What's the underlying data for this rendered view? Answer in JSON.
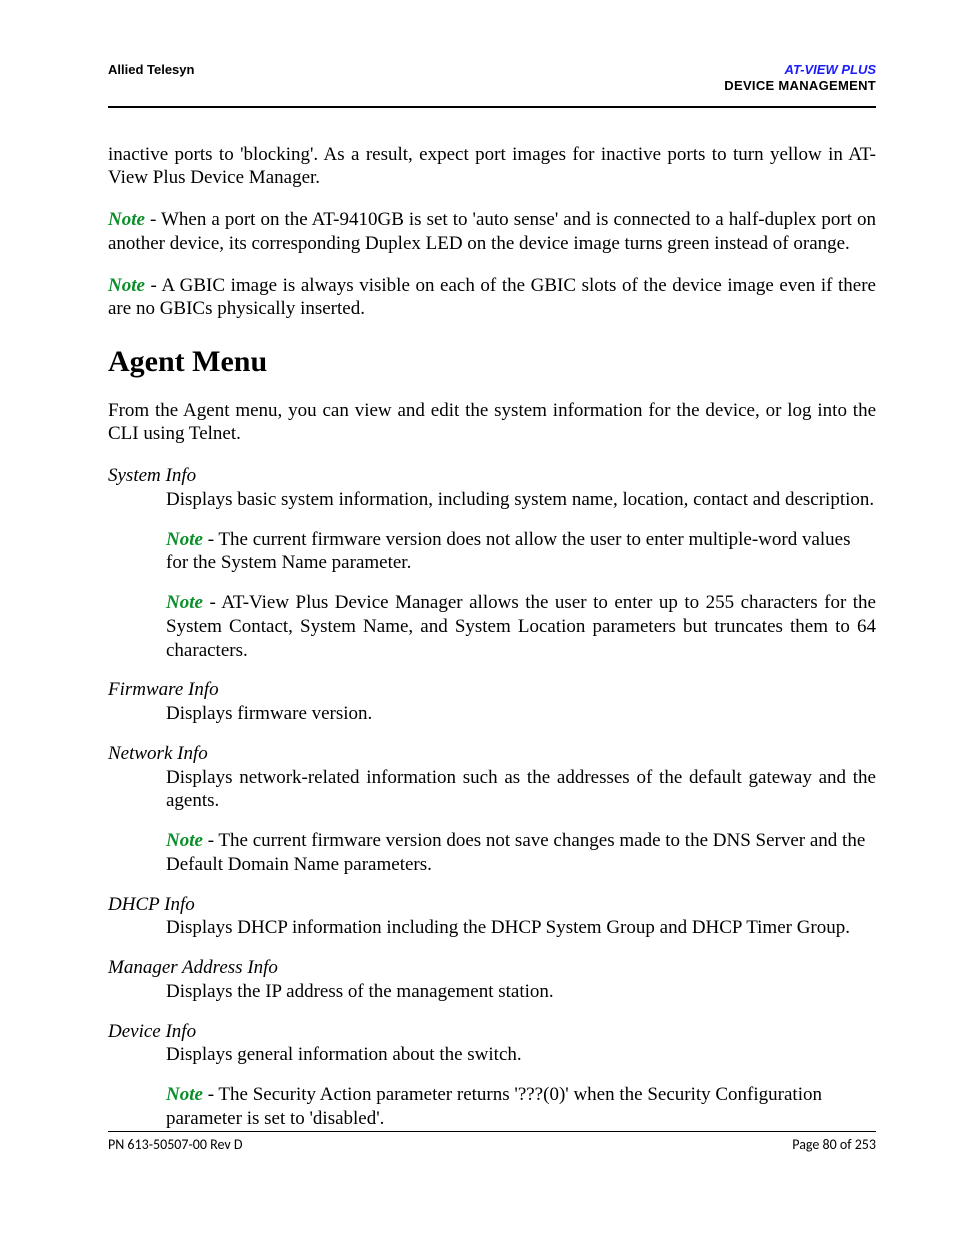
{
  "header": {
    "left": "Allied Telesyn",
    "product": "AT-VIEW PLUS",
    "doc_title": "DEVICE MANAGEMENT"
  },
  "intro_para": "inactive ports to 'blocking'. As a result, expect port images for inactive ports to turn yellow in AT-View Plus Device Manager.",
  "top_notes": [
    {
      "label": "Note",
      "text": " - When a port on the AT-9410GB is set to 'auto sense' and is connected to a half-duplex port on another device, its corresponding Duplex LED on the device image turns green instead of orange."
    },
    {
      "label": "Note",
      "text": " - A GBIC image is always visible on each of the GBIC slots of the device image even if there are no GBICs physically inserted."
    }
  ],
  "section_heading": "Agent Menu",
  "section_intro": "From the Agent menu, you can view and edit the system information for the device, or log into the CLI using Telnet.",
  "items": [
    {
      "term": "System Info",
      "desc": "Displays basic system information, including system name, location, contact and description.",
      "notes": [
        {
          "label": "Note",
          "text": " - The current firmware version does not allow the user to enter multiple-word values for the System Name parameter."
        },
        {
          "label": "Note",
          "text": " - AT-View Plus Device Manager allows the user to enter up to 255 characters for the System Contact, System Name, and System Location parameters but truncates them to 64 characters.",
          "justify": true
        }
      ]
    },
    {
      "term": "Firmware Info",
      "desc": "Displays firmware version.",
      "notes": []
    },
    {
      "term": "Network Info",
      "desc": "Displays network-related information such as the addresses of the default gateway and the agents.",
      "desc_justify": true,
      "notes": [
        {
          "label": "Note",
          "text": " - The current firmware version does not save changes made to the DNS Server and the Default Domain Name parameters."
        }
      ]
    },
    {
      "term": "DHCP Info",
      "desc": "Displays DHCP information including the DHCP System Group and DHCP Timer Group.",
      "notes": []
    },
    {
      "term": "Manager Address Info",
      "desc": "Displays the IP address of the management station.",
      "notes": []
    },
    {
      "term": "Device Info",
      "desc": "Displays general information about the switch.",
      "notes": [
        {
          "label": "Note",
          "text": " - The Security Action parameter returns '???(0)' when the Security Configuration parameter is set to 'disabled'."
        }
      ]
    }
  ],
  "footer": {
    "left": "PN 613-50507-00 Rev D",
    "right": "Page 80 of 253"
  }
}
